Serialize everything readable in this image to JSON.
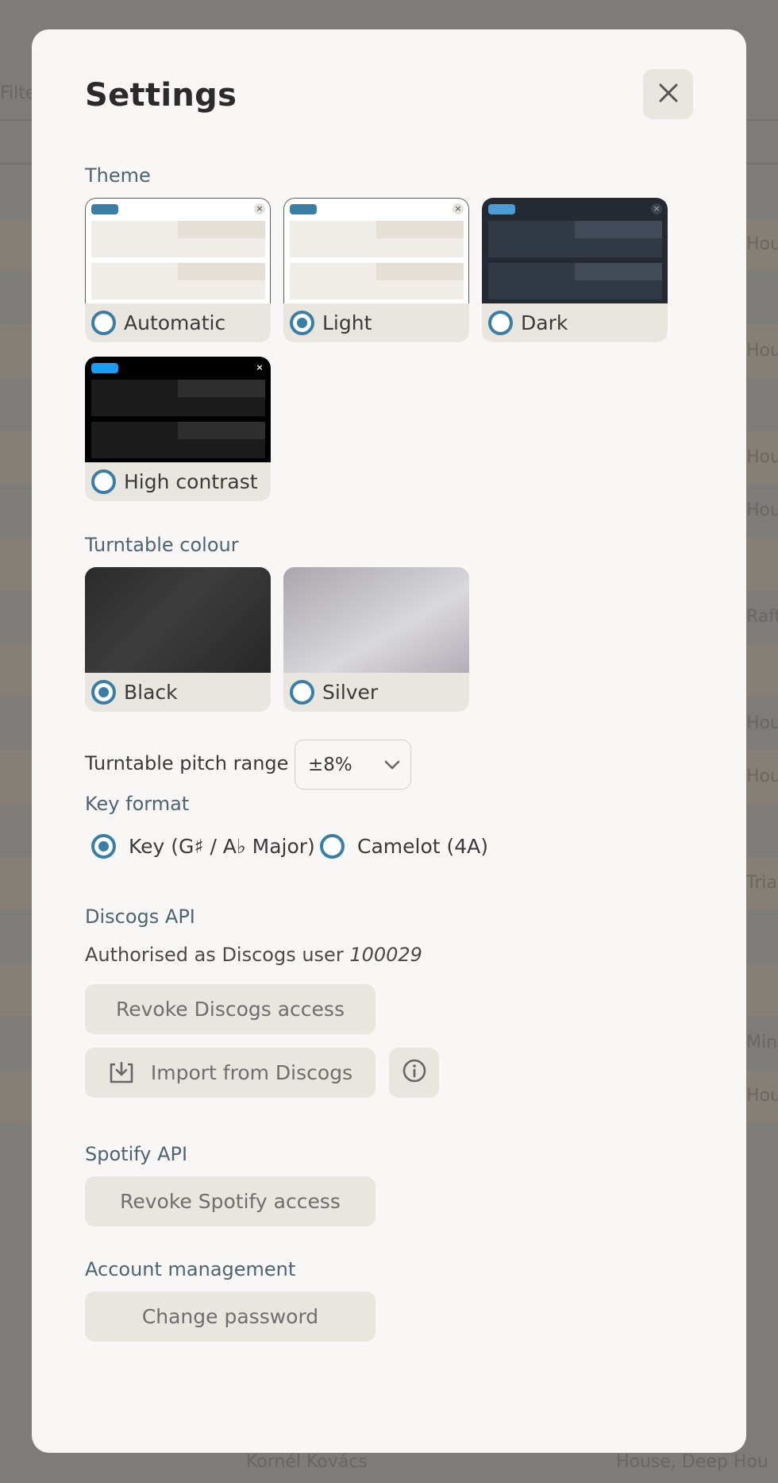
{
  "background": {
    "rows": [
      {
        "text": "Hou"
      },
      {
        "text": ""
      },
      {
        "text": "Hou"
      },
      {
        "text": ""
      },
      {
        "text": "Hou"
      },
      {
        "text": "Hou"
      },
      {
        "text": ""
      },
      {
        "text": "Raft"
      },
      {
        "text": ""
      },
      {
        "text": "Hou"
      },
      {
        "text": "Hou"
      },
      {
        "text": ""
      },
      {
        "text": "Tria"
      },
      {
        "text": ""
      },
      {
        "text": ""
      },
      {
        "text": "Mini"
      },
      {
        "text": "Hou"
      }
    ],
    "filter_text": "Filte",
    "footer_artist": "Kornél Kovács",
    "footer_genre": "House, Deep Hou"
  },
  "modal": {
    "title": "Settings",
    "close_label": "close"
  },
  "theme": {
    "label": "Theme",
    "options": [
      {
        "label": "Automatic",
        "selected": false
      },
      {
        "label": "Light",
        "selected": true
      },
      {
        "label": "Dark",
        "selected": false
      },
      {
        "label": "High contrast",
        "selected": false
      }
    ]
  },
  "turntable_colour": {
    "label": "Turntable colour",
    "options": [
      {
        "label": "Black",
        "selected": true
      },
      {
        "label": "Silver",
        "selected": false
      }
    ]
  },
  "pitch_range": {
    "label": "Turntable pitch range",
    "value": "±8%"
  },
  "key_format": {
    "label": "Key format",
    "options": [
      {
        "label": "Key (G♯ / A♭ Major)",
        "selected": true
      },
      {
        "label": "Camelot (4A)",
        "selected": false
      }
    ]
  },
  "discogs": {
    "label": "Discogs API",
    "status_prefix": "Authorised as Discogs user",
    "user": "100029",
    "revoke_label": "Revoke Discogs access",
    "import_label": "Import from Discogs"
  },
  "spotify": {
    "label": "Spotify API",
    "revoke_label": "Revoke Spotify access"
  },
  "account": {
    "label": "Account management",
    "change_password_label": "Change password"
  },
  "colors": {
    "accent": "#3a7ea6",
    "button_bg": "#e9e6e0",
    "section_label": "#4d6473"
  },
  "icons": {
    "close": "close-icon",
    "chevron": "chevron-down-icon",
    "import": "download-tray-icon",
    "info": "info-icon"
  }
}
